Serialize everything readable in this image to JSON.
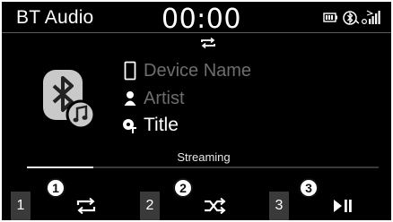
{
  "header": {
    "title": "BT Audio",
    "clock": "00:00",
    "status_icons": [
      "battery-icon",
      "bluetooth-phone-icon",
      "signal-icon"
    ]
  },
  "now_playing": {
    "mode_indicator_icon": "repeat-icon",
    "art_icon": "bluetooth-music-icon",
    "device_name": "Device Name",
    "artist": "Artist",
    "title": "Title",
    "status_text": "Streaming",
    "progress_fraction": 0.19
  },
  "bottom_bar": {
    "buttons": [
      {
        "number": "1",
        "icon": "repeat-icon"
      },
      {
        "number": "2",
        "icon": "shuffle-icon"
      },
      {
        "number": "3",
        "icon": "play-pause-icon",
        "label": "▶II"
      }
    ]
  },
  "callouts": [
    "1",
    "2",
    "3"
  ],
  "colors": {
    "background": "#000000",
    "text": "#ffffff",
    "dim_text": "#6e6e6e",
    "number_cell": "#3a3a3a"
  }
}
